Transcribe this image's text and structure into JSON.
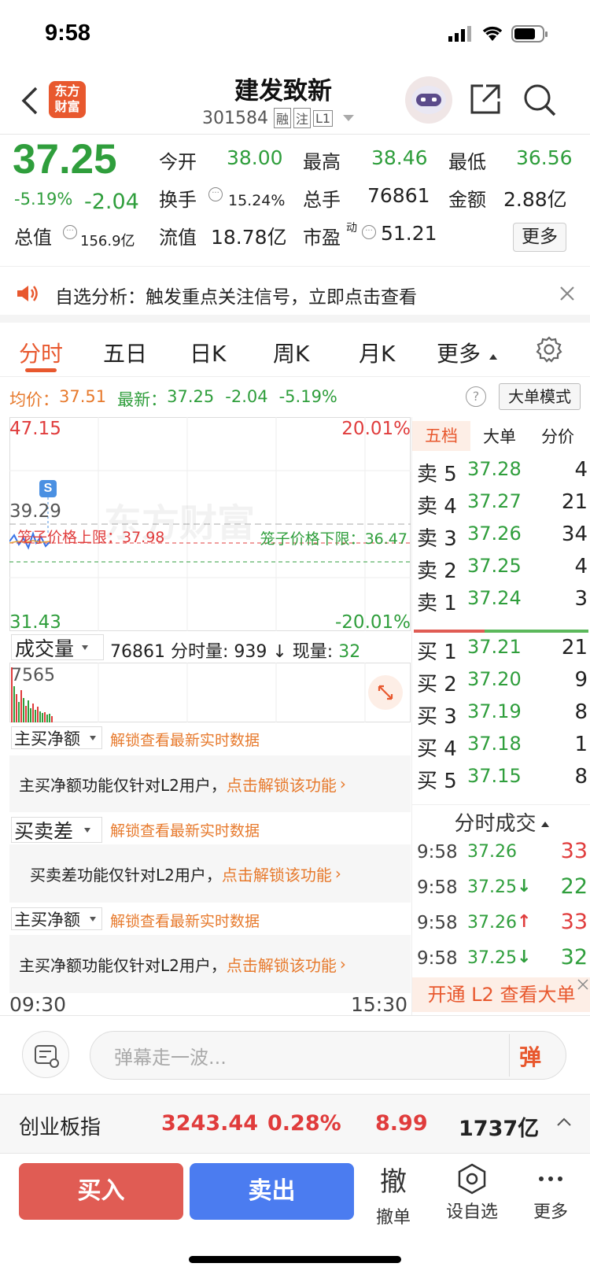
{
  "status": {
    "time": "9:58"
  },
  "header": {
    "title": "建发致新",
    "code": "301584",
    "tags": [
      "融",
      "注",
      "L1"
    ],
    "logo_line1": "东方",
    "logo_line2": "财富"
  },
  "quote": {
    "price": "37.25",
    "pct": "-5.19%",
    "chg": "-2.04",
    "row1": [
      {
        "label": "今开",
        "value": "38.00"
      },
      {
        "label": "最高",
        "value": "38.46"
      },
      {
        "label": "最低",
        "value": "36.56"
      }
    ],
    "row2": [
      {
        "label": "换手",
        "value": "15.24%"
      },
      {
        "label": "总手",
        "value": "76861"
      },
      {
        "label": "金额",
        "value": "2.88亿"
      }
    ],
    "total_label": "总值",
    "total_value": "156.9亿",
    "float_label": "流值",
    "float_value": "18.78亿",
    "pe_label": "市盈",
    "pe_sup": "动",
    "pe_value": "51.21",
    "more_btn": "更多"
  },
  "notice": {
    "text": "自选分析：触发重点关注信号，立即点击查看"
  },
  "tabs": [
    "分时",
    "五日",
    "日K",
    "周K",
    "月K",
    "更多"
  ],
  "info_bar": {
    "avg_label": "均价：",
    "avg": "37.51",
    "latest_label": "最新：",
    "latest": "37.25",
    "chg": "-2.04",
    "pct": "-5.19%",
    "mode_btn": "大单模式"
  },
  "chart": {
    "top_price": "47.15",
    "top_pct": "20.01%",
    "bottom_price": "31.43",
    "bottom_pct": "-20.01%",
    "mid_price": "39.29",
    "watermark": "东方财富",
    "upper_limit": "笼子价格上限：37.98",
    "lower_limit": "笼子价格下限：36.47",
    "s_marker": "S",
    "vol_dropdown": "成交量",
    "vol_info": "76861 分时量: 939 ↓ 现量: ",
    "vol_now": "32",
    "vol_axis": "7565",
    "time_start": "09:30",
    "time_end": "15:30"
  },
  "panels": [
    {
      "dropdown": "主买净额",
      "unlock": "解锁查看最新实时数据",
      "msg": "主买净额功能仅针对L2用户，",
      "link": "点击解锁该功能"
    },
    {
      "dropdown": "买卖差",
      "unlock": "解锁查看最新实时数据",
      "msg": "买卖差功能仅针对L2用户，",
      "link": "点击解锁该功能"
    },
    {
      "dropdown": "主买净额",
      "unlock": "解锁查看最新实时数据",
      "msg": "主买净额功能仅针对L2用户，",
      "link": "点击解锁该功能"
    }
  ],
  "book": {
    "tabs": [
      "五档",
      "大单",
      "分价"
    ],
    "sell": [
      {
        "label": "卖 5",
        "price": "37.28",
        "vol": "4"
      },
      {
        "label": "卖 4",
        "price": "37.27",
        "vol": "21"
      },
      {
        "label": "卖 3",
        "price": "37.26",
        "vol": "34"
      },
      {
        "label": "卖 2",
        "price": "37.25",
        "vol": "4"
      },
      {
        "label": "卖 1",
        "price": "37.24",
        "vol": "3"
      }
    ],
    "buy": [
      {
        "label": "买 1",
        "price": "37.21",
        "vol": "21"
      },
      {
        "label": "买 2",
        "price": "37.20",
        "vol": "9"
      },
      {
        "label": "买 3",
        "price": "37.19",
        "vol": "8"
      },
      {
        "label": "买 4",
        "price": "37.18",
        "vol": "1"
      },
      {
        "label": "买 5",
        "price": "37.15",
        "vol": "8"
      }
    ],
    "trades_title": "分时成交",
    "trades": [
      {
        "time": "9:58",
        "price": "37.26",
        "arrow": "",
        "vol": "33",
        "color": "red"
      },
      {
        "time": "9:58",
        "price": "37.25",
        "arrow": "↓",
        "vol": "22",
        "color": "green"
      },
      {
        "time": "9:58",
        "price": "37.26",
        "arrow": "↑",
        "vol": "33",
        "color": "red"
      },
      {
        "time": "9:58",
        "price": "37.25",
        "arrow": "↓",
        "vol": "32",
        "color": "green"
      }
    ],
    "l2_banner": "开通 L2 查看大单"
  },
  "danmu": {
    "placeholder": "弹幕走一波...",
    "send": "弹"
  },
  "index_bar": {
    "name": "创业板指",
    "value": "3243.44",
    "pct": "0.28%",
    "chg": "8.99",
    "amount": "1737亿"
  },
  "bottom": {
    "buy": "买入",
    "sell": "卖出",
    "cancel_glyph": "撤",
    "cancel": "撤单",
    "watch": "设自选",
    "more": "更多"
  },
  "colors": {
    "up": "#e03c3c",
    "down": "#2f9e3c",
    "accent": "#e77a2d",
    "sell_btn": "#4b7cf0",
    "buy_btn": "#e05c54"
  }
}
